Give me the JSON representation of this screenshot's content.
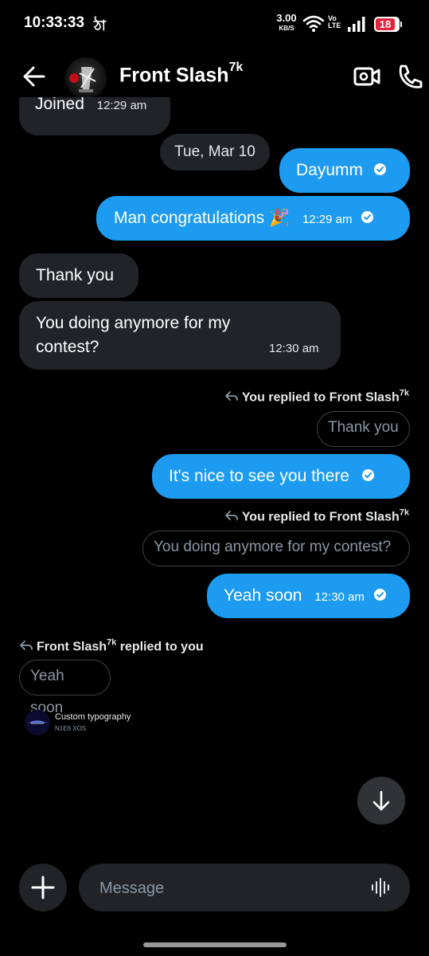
{
  "status_bar": {
    "time": "10:33:33",
    "carrier_glyph": "ঠা",
    "net_speed_value": "3.00",
    "net_speed_unit": "KB/S",
    "volte_top": "Vo",
    "volte_bottom": "LTE",
    "battery": "18"
  },
  "header": {
    "contact_name": "Front Slash",
    "contact_sup": "7k"
  },
  "messages": {
    "partial_text": "Joined",
    "partial_time": "12:29 am",
    "date_separator": "Tue, Mar 10",
    "out1_text": "Dayumm",
    "out2_text": "Man congratulations 🎉",
    "out2_time": "12:29 am",
    "in1_text": "Thank you",
    "in2_line1": "You doing anymore for my",
    "in2_line2": "contest?",
    "in2_time": "12:30 am",
    "reply1_note": "You replied to Front Slash",
    "reply1_sup": "7k",
    "reply1_quote": "Thank you",
    "out3_text": "It's nice to see you there",
    "reply2_note": "You replied to Front Slash",
    "reply2_sup": "7k",
    "reply2_quote": "You doing anymore for my contest?",
    "out4_text": "Yeah soon",
    "out4_time": "12:30 am",
    "reply3_name": "Front Slash",
    "reply3_sup": "7k",
    "reply3_suffix": " replied to you",
    "reply3_quote": "Yeah soon"
  },
  "watermark": {
    "line1": "Custom typography",
    "line2": "N1E6 XOS"
  },
  "composer": {
    "placeholder": "Message"
  },
  "colors": {
    "accent": "#1d9bf0",
    "incoming": "#202327",
    "background": "#000000"
  },
  "icons": [
    "back-arrow-icon",
    "video-call-icon",
    "phone-icon",
    "check-icon",
    "reply-arrow-icon",
    "plus-icon",
    "voice-wave-icon",
    "arrow-down-icon",
    "wifi-icon",
    "signal-icon"
  ]
}
